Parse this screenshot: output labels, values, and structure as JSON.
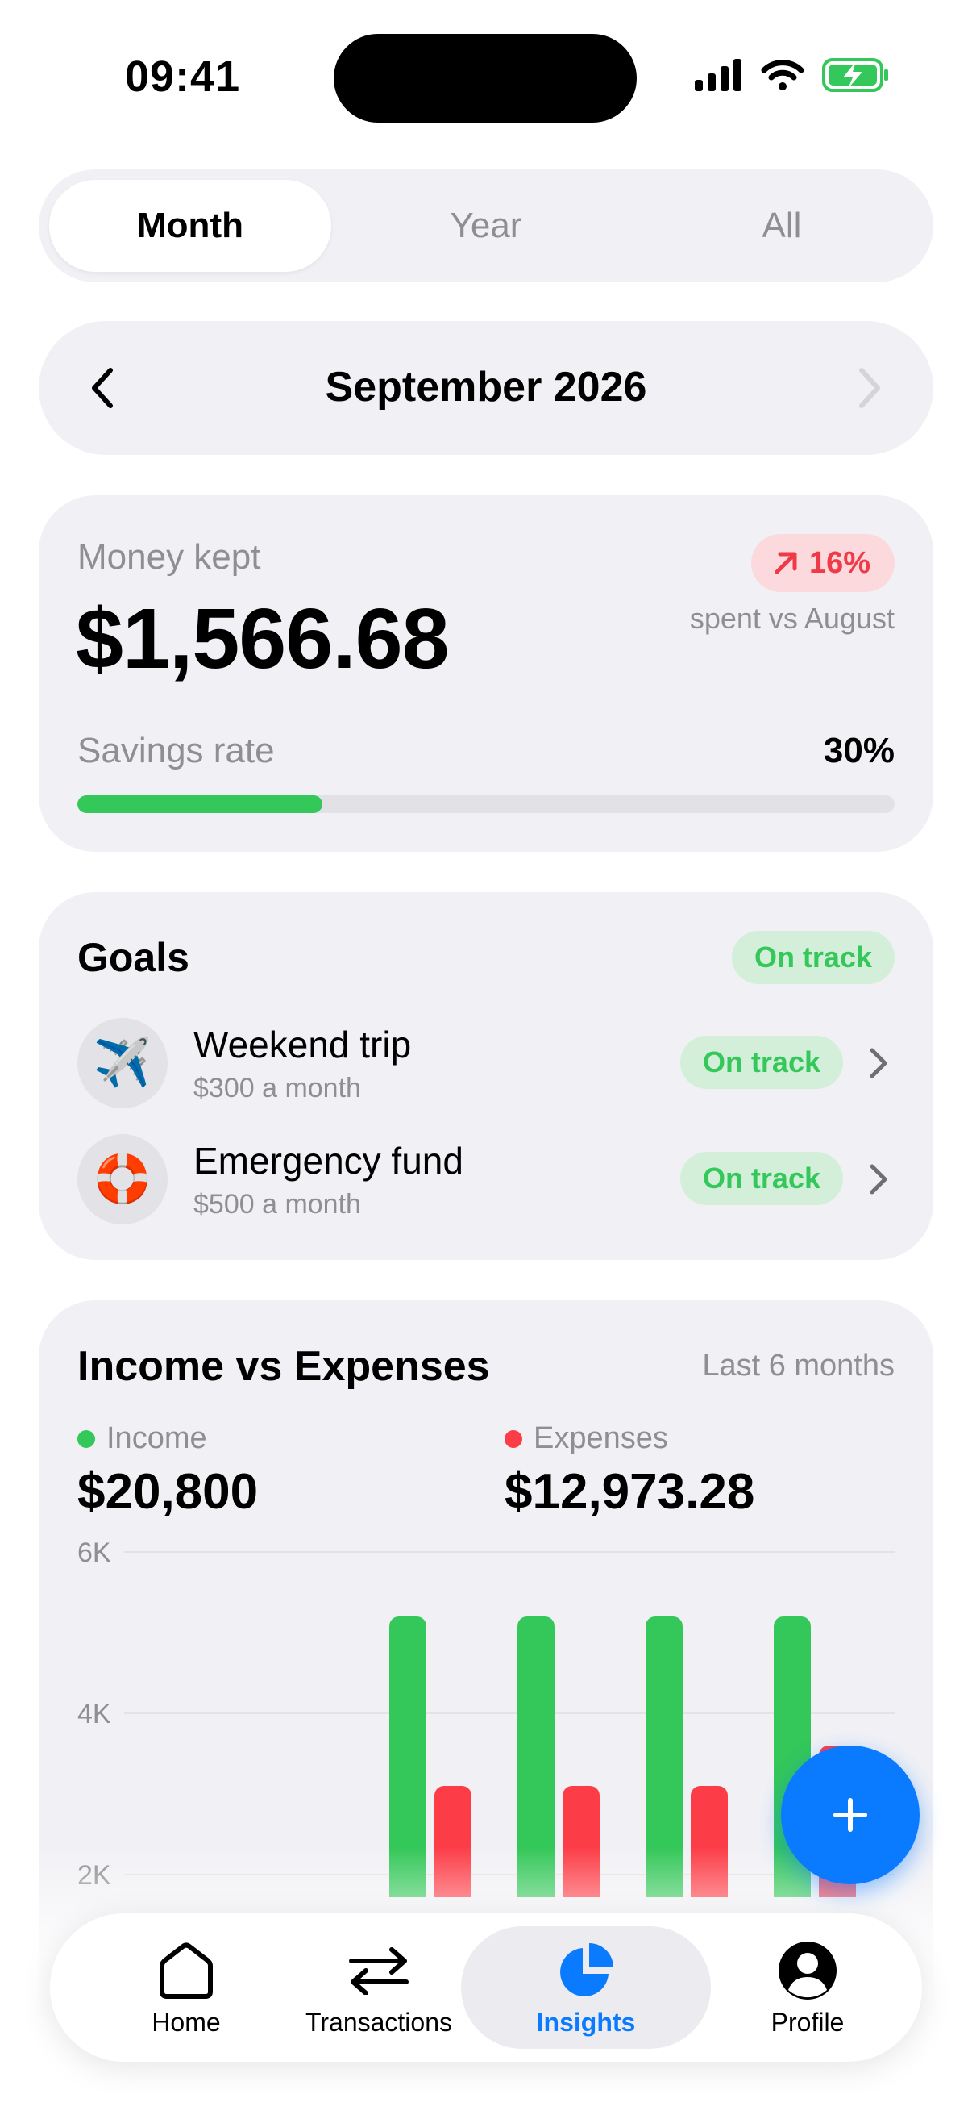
{
  "status": {
    "time": "09:41"
  },
  "period_tabs": [
    {
      "label": "Month",
      "active": true
    },
    {
      "label": "Year",
      "active": false
    },
    {
      "label": "All",
      "active": false
    }
  ],
  "month_nav": {
    "title": "September 2026"
  },
  "summary": {
    "kept_label": "Money kept",
    "kept_value": "$1,566.68",
    "trend_value": "16%",
    "trend_sub": "spent vs August",
    "rate_label": "Savings rate",
    "rate_value": "30%",
    "rate_fraction": 0.3
  },
  "goals": {
    "title": "Goals",
    "status": "On track",
    "items": [
      {
        "icon": "airplane-icon",
        "emoji": "✈️",
        "name": "Weekend trip",
        "sub": "$300 a month",
        "status": "On track"
      },
      {
        "icon": "life-buoy-icon",
        "emoji": "🛟",
        "name": "Emergency fund",
        "sub": "$500 a month",
        "status": "On track"
      }
    ]
  },
  "income_expenses": {
    "title": "Income vs Expenses",
    "period": "Last 6 months",
    "income_label": "Income",
    "income_total": "$20,800",
    "expenses_label": "Expenses",
    "expenses_total": "$12,973.28"
  },
  "chart_data": {
    "type": "bar",
    "categories": [
      "",
      "",
      "",
      "",
      "",
      ""
    ],
    "series": [
      {
        "name": "Income",
        "color": "#34c759",
        "values": [
          0,
          0,
          5200,
          5200,
          5200,
          5200
        ]
      },
      {
        "name": "Expenses",
        "color": "#fc3d47",
        "values": [
          0,
          0,
          3100,
          3100,
          3100,
          3600
        ]
      }
    ],
    "y_ticks": [
      "6K",
      "4K",
      "2K"
    ],
    "ylim": [
      0,
      6000
    ],
    "grid": true
  },
  "tabbar": {
    "items": [
      {
        "label": "Home",
        "icon": "home-icon",
        "active": false
      },
      {
        "label": "Transactions",
        "icon": "transfer-icon",
        "active": false
      },
      {
        "label": "Insights",
        "icon": "pie-chart-icon",
        "active": true
      },
      {
        "label": "Profile",
        "icon": "profile-icon",
        "active": false
      }
    ]
  },
  "colors": {
    "accent": "#0a7aff",
    "income": "#34c759",
    "expense": "#fc3d47",
    "card": "#f1f1f5"
  }
}
